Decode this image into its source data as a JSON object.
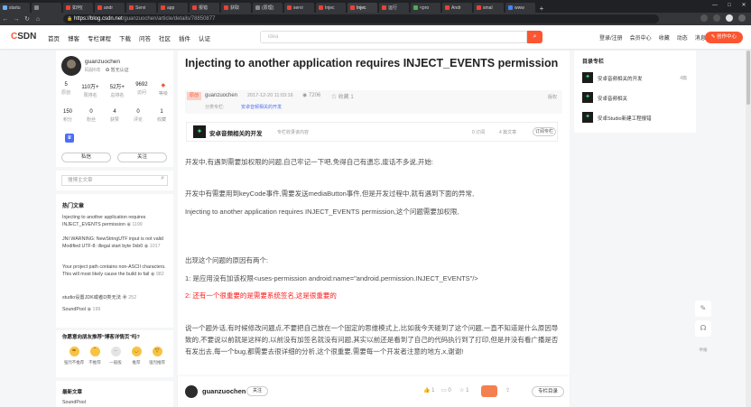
{
  "browser": {
    "tabs": [
      {
        "title": "startu",
        "color": "#6ab0f3"
      },
      {
        "title": "",
        "color": "#888888"
      },
      {
        "title": "如何(",
        "color": "#e94335"
      },
      {
        "title": "andr",
        "color": "#e94335"
      },
      {
        "title": "Servi",
        "color": "#e94335"
      },
      {
        "title": "app",
        "color": "#e94335"
      },
      {
        "title": "报错",
        "color": "#e94335"
      },
      {
        "title": "获取",
        "color": "#e94335"
      },
      {
        "title": "(原理)",
        "color": "#888888"
      },
      {
        "title": "servi",
        "color": "#e94335"
      },
      {
        "title": "Injec",
        "color": "#e94335"
      },
      {
        "title": "Injec",
        "color": "#e94335",
        "active": true
      },
      {
        "title": "运行",
        "color": "#e94335"
      },
      {
        "title": "<pro",
        "color": "#4caf50"
      },
      {
        "title": "Andr",
        "color": "#e94335"
      },
      {
        "title": "smal",
        "color": "#e94335"
      },
      {
        "title": "www",
        "color": "#4285f4"
      }
    ],
    "newtab": "+",
    "controls": [
      "—",
      "□",
      "✕"
    ],
    "url_domain": "https://blog.csdn.net",
    "url_path": "/guanzuochen/article/details/78850877"
  },
  "header": {
    "logo_c": "C",
    "logo_rest": "SDN",
    "nav": [
      "首页",
      "博客",
      "专栏课程",
      "下载",
      "问答",
      "社区",
      "插件",
      "认证"
    ],
    "search_placeholder": "idea",
    "right": [
      "登录/注册",
      "会员中心",
      "收藏",
      "动态",
      "消息"
    ],
    "create_label": "✎ 创作中心"
  },
  "author": {
    "name": "guanzuochen",
    "years": "码龄6年",
    "verify": "暂无认证",
    "stats1": [
      {
        "n": "5",
        "l": "原创"
      },
      {
        "n": "110万+",
        "l": "周排名"
      },
      {
        "n": "52万+",
        "l": "总排名"
      },
      {
        "n": "9692",
        "l": "访问"
      },
      {
        "n": "",
        "l": "等级"
      }
    ],
    "stats2": [
      {
        "n": "150",
        "l": "积分"
      },
      {
        "n": "0",
        "l": "粉丝"
      },
      {
        "n": "4",
        "l": "获赞"
      },
      {
        "n": "0",
        "l": "评论"
      },
      {
        "n": "1",
        "l": "收藏"
      }
    ],
    "msg_label": "私信",
    "follow_label": "关注"
  },
  "sidebar_search": {
    "placeholder": "搜博主文章"
  },
  "hot": {
    "title": "热门文章",
    "items": [
      {
        "text": "Injecting to another application requires INJECT_EVENTS permission",
        "count": "1199"
      },
      {
        "text": "JNI WARNING: NewStringUTF input is not valid Modified UTF-8: illegal start byte 0xb0",
        "count": "1017"
      },
      {
        "text": "Your project path contains non-ASCII characters. This will most likely cause the build to fail",
        "count": "982"
      },
      {
        "text": "studio设置JDK或者D类无法",
        "count": "252"
      },
      {
        "text": "SoundPool",
        "count": "199"
      }
    ]
  },
  "rating": {
    "title": "你愿意向朋友推荐“博客详情页”吗?",
    "options": [
      {
        "face": "≖",
        "label": "强烈不推荐"
      },
      {
        "face": "˘",
        "label": "不推荐"
      },
      {
        "face": "–",
        "label": "一般般"
      },
      {
        "face": "◡",
        "label": "推荐"
      },
      {
        "face": "▽",
        "label": "强烈推荐"
      }
    ]
  },
  "newest": {
    "title": "最新文章",
    "item": "SoundPool"
  },
  "article": {
    "title": "Injecting to another application requires INJECT_EVENTS permission",
    "original_tag": "原创",
    "author": "guanzuochen",
    "date": "2017-12-20 11:03:16",
    "views": "7206",
    "favorites": "收藏 1",
    "copyright": "版权",
    "column_label": "分类专栏:",
    "column_tag": "安卓音频相关的开发",
    "column_box": {
      "name": "安卓音频相关的开发",
      "sub": "专栏收录该内容",
      "articles": "0 订阅",
      "count": "4 篇文章",
      "subscribe": "订阅专栏"
    },
    "paragraphs": [
      "开发中,有遇到需要加权限的问题,自己牢记一下吧,免得自己有遗忘,废话不多说,开始:",
      "开发中有需要用到keyCode事件,需要发送mediaButton事件,但是开发过程中,就有遇到下面的异常,",
      "Injecting to another application requires INJECT_EVENTS permission,这个问题需要加权限,",
      "出现这个问题的原因有两个:",
      "1:  是应用没有加该权限<uses-permission android:name=\"android.permission.INJECT_EVENTS\"/>",
      "2: 还有一个很重要的是需要系统签名,这是很重要的",
      "说一个题外话,有时候修改问题点,不要把自己放在一个固定的思维模式上,比如我今天碰到了这个问题,一直不知道是什么原因导致的,不要说以前就是这样的,以前没有加签名就没有问题,其实以前还是看到了自己的代码执行到了打印,但是并没有看广播是否有发出去,每一个bug,都需要去很详细的分析,这个很重要,需要每一个开发者注意的地方,x,谢谢!"
    ]
  },
  "bottom": {
    "name": "guanzuochen",
    "follow": "关注",
    "likes": "1",
    "comments": "0",
    "favs": "1",
    "dir": "专栏目录"
  },
  "right_col": {
    "title": "目录专栏",
    "items": [
      {
        "text": "安卓音频相关的开发",
        "count": "4篇"
      },
      {
        "text": "安卓音频相关",
        "count": ""
      },
      {
        "text": "安卓Studio新建工程报错",
        "count": ""
      }
    ]
  },
  "float": {
    "top_label": "举报"
  }
}
